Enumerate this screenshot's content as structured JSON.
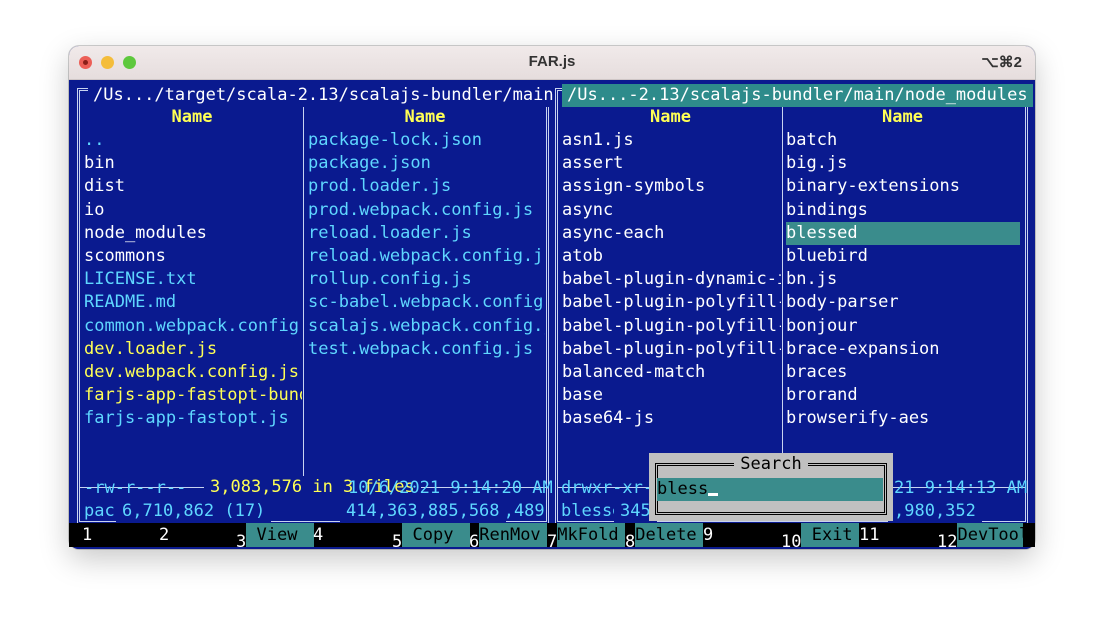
{
  "window": {
    "title": "FAR.js",
    "shortcut": "⌥⌘2"
  },
  "left_panel": {
    "path": "/Us.../target/scala-2.13/scalajs-bundler/main",
    "col_header_1": "Name",
    "col_header_2": "Name",
    "column1": [
      {
        "name": "..",
        "color": "cyan"
      },
      {
        "name": "bin",
        "color": "white"
      },
      {
        "name": "dist",
        "color": "white"
      },
      {
        "name": "io",
        "color": "white"
      },
      {
        "name": "node_modules",
        "color": "white"
      },
      {
        "name": "scommons",
        "color": "white"
      },
      {
        "name": "LICENSE.txt",
        "color": "cyan"
      },
      {
        "name": "README.md",
        "color": "cyan"
      },
      {
        "name": "common.webpack.config.}",
        "color": "cyan"
      },
      {
        "name": "dev.loader.js",
        "color": "yellow"
      },
      {
        "name": "dev.webpack.config.js",
        "color": "yellow"
      },
      {
        "name": "farjs-app-fastopt-bund}",
        "color": "yellow"
      },
      {
        "name": "farjs-app-fastopt.js",
        "color": "cyan"
      }
    ],
    "column2": [
      {
        "name": "package-lock.json",
        "color": "cyan"
      },
      {
        "name": "package.json",
        "color": "cyan"
      },
      {
        "name": "prod.loader.js",
        "color": "cyan"
      },
      {
        "name": "prod.webpack.config.js",
        "color": "cyan"
      },
      {
        "name": "reload.loader.js",
        "color": "cyan"
      },
      {
        "name": "reload.webpack.config.js",
        "color": "cyan"
      },
      {
        "name": "rollup.config.js",
        "color": "cyan"
      },
      {
        "name": "sc-babel.webpack.config.}",
        "color": "cyan"
      },
      {
        "name": "scalajs.webpack.config.j}",
        "color": "cyan"
      },
      {
        "name": "test.webpack.config.js",
        "color": "cyan"
      }
    ],
    "summary": "3,083,576 in 3 files",
    "file_name": "package-lock.json",
    "file_size": "643,489",
    "file_perms": "-rw-r--r--",
    "file_date": "10/6/2021 9:14:20 AM",
    "bottom_left": "6,710,862 (17)",
    "bottom_right": "414,363,885,568"
  },
  "right_panel": {
    "path": "/Us...-2.13/scalajs-bundler/main/node_modules",
    "col_header_1": "Name",
    "col_header_2": "Name",
    "column1": [
      {
        "name": "asn1.js",
        "color": "white"
      },
      {
        "name": "assert",
        "color": "white"
      },
      {
        "name": "assign-symbols",
        "color": "white"
      },
      {
        "name": "async",
        "color": "white"
      },
      {
        "name": "async-each",
        "color": "white"
      },
      {
        "name": "atob",
        "color": "white"
      },
      {
        "name": "babel-plugin-dynamic-i}",
        "color": "white"
      },
      {
        "name": "babel-plugin-polyfill-}",
        "color": "white"
      },
      {
        "name": "babel-plugin-polyfill-}",
        "color": "white"
      },
      {
        "name": "babel-plugin-polyfill-}",
        "color": "white"
      },
      {
        "name": "balanced-match",
        "color": "white"
      },
      {
        "name": "base",
        "color": "white"
      },
      {
        "name": "base64-js",
        "color": "white"
      }
    ],
    "column2": [
      {
        "name": "batch",
        "color": "white"
      },
      {
        "name": "big.js",
        "color": "white"
      },
      {
        "name": "binary-extensions",
        "color": "white"
      },
      {
        "name": "bindings",
        "color": "white"
      },
      {
        "name": "blessed",
        "color": "white",
        "selected": true
      },
      {
        "name": "bluebird",
        "color": "white"
      },
      {
        "name": "bn.js",
        "color": "white"
      },
      {
        "name": "body-parser",
        "color": "white"
      },
      {
        "name": "bonjour",
        "color": "white"
      },
      {
        "name": "brace-expansion",
        "color": "white"
      },
      {
        "name": "braces",
        "color": "white"
      },
      {
        "name": "brorand",
        "color": "white"
      },
      {
        "name": "browserify-aes",
        "color": "white"
      }
    ],
    "file_name": "blessed",
    "file_perms": "drwxr-xr-",
    "file_date_tail": "21 9:14:13 AM",
    "bottom_left": "345",
    "bottom_right": ",980,352"
  },
  "search_dialog": {
    "title": "Search",
    "value": "bless"
  },
  "fkeys": [
    {
      "num": "1",
      "label": ""
    },
    {
      "num": "2",
      "label": ""
    },
    {
      "num": "3",
      "label": " View"
    },
    {
      "num": "4",
      "label": ""
    },
    {
      "num": "5",
      "label": " Copy"
    },
    {
      "num": "6",
      "label": "RenMov"
    },
    {
      "num": "7",
      "label": "MkFold"
    },
    {
      "num": "8",
      "label": "Delete"
    },
    {
      "num": "9",
      "label": ""
    },
    {
      "num": "10",
      "label": " Exit"
    },
    {
      "num": "11",
      "label": ""
    },
    {
      "num": "12",
      "label": "DevTools"
    }
  ]
}
